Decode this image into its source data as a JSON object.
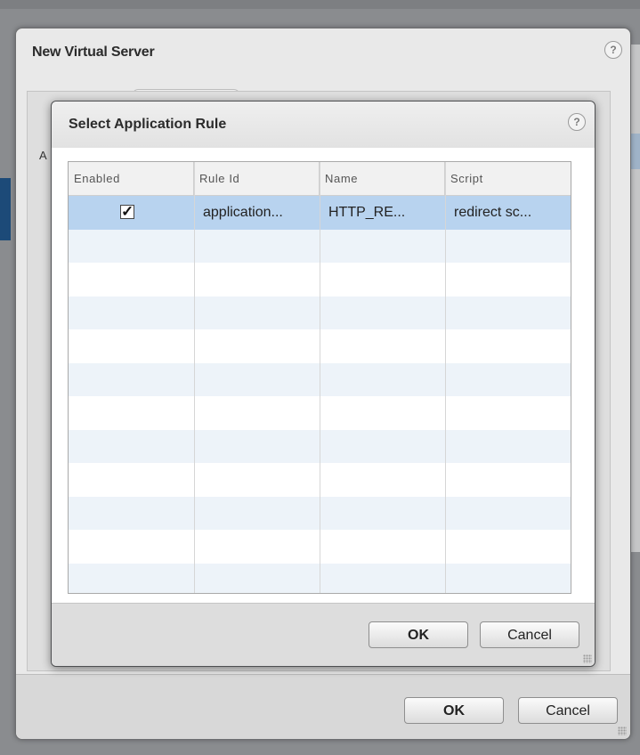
{
  "outer_dialog": {
    "title": "New Virtual Server",
    "help_icon": "?",
    "side_label": "A",
    "ok_label": "OK",
    "cancel_label": "Cancel"
  },
  "inner_dialog": {
    "title": "Select Application Rule",
    "help_icon": "?",
    "columns": [
      "Enabled",
      "Rule Id",
      "Name",
      "Script"
    ],
    "rows": [
      {
        "enabled": true,
        "check_glyph": "✓",
        "rule_id": "application...",
        "name": "HTTP_RE...",
        "script": "redirect sc..."
      }
    ],
    "ok_label": "OK",
    "cancel_label": "Cancel"
  },
  "colors": {
    "selected_row": "#b8d3ef",
    "alt_row": "#edf3f9",
    "overlay": "#8a8c8f"
  }
}
